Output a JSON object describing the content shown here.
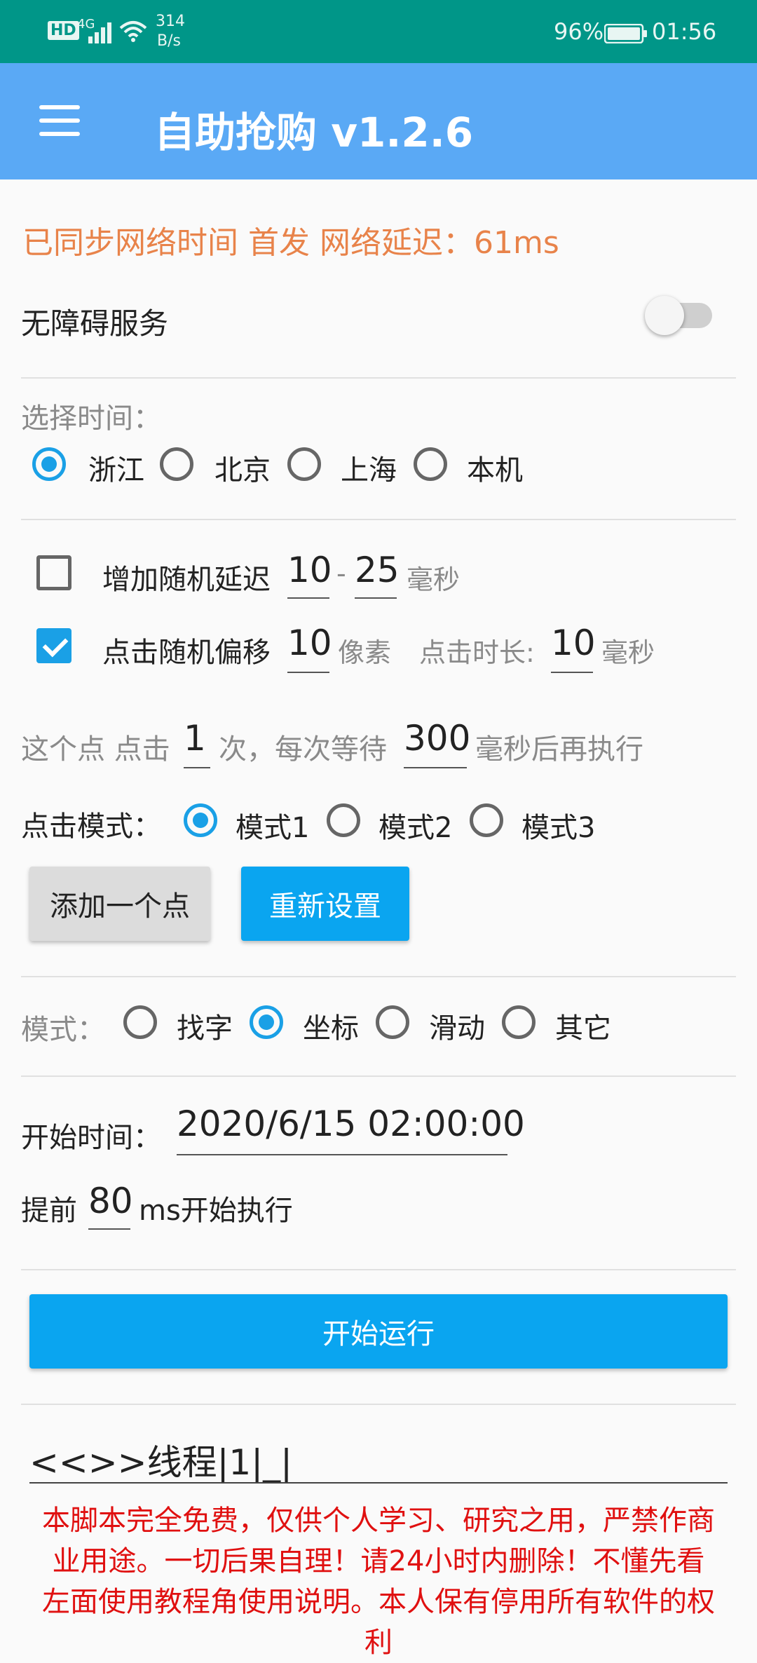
{
  "status_bar": {
    "hd": "HD",
    "network": "4G",
    "speed": "314",
    "speed_unit": "B/s",
    "battery": "96%",
    "time": "01:56"
  },
  "app_bar": {
    "title": "自助抢购 v1.2.6",
    "menu_icon": "hamburger-menu-icon"
  },
  "sync_status": "已同步网络时间 首发 网络延迟：61ms",
  "accessibility": {
    "label": "无障碍服务",
    "enabled": false
  },
  "time_select": {
    "label": "选择时间：",
    "options": [
      "浙江",
      "北京",
      "上海",
      "本机"
    ],
    "selected": "浙江"
  },
  "random_delay": {
    "checked": false,
    "label": "增加随机延迟",
    "min": "10",
    "dash": "-",
    "max": "25",
    "unit": "毫秒"
  },
  "random_offset": {
    "checked": true,
    "label": "点击随机偏移",
    "value": "10",
    "unit": "像素",
    "duration_label": "点击时长:",
    "duration_value": "10",
    "duration_unit": "毫秒"
  },
  "click_repeat": {
    "prefix": "这个点 点击",
    "count": "1",
    "middle": "次，每次等待",
    "wait": "300",
    "suffix": "毫秒后再执行"
  },
  "click_mode": {
    "label": "点击模式：",
    "options": [
      "模式1",
      "模式2",
      "模式3"
    ],
    "selected": "模式1"
  },
  "buttons": {
    "add_point": "添加一个点",
    "reset": "重新设置",
    "start": "开始运行"
  },
  "mode": {
    "label": "模式：",
    "options": [
      "找字",
      "坐标",
      "滑动",
      "其它"
    ],
    "selected": "坐标"
  },
  "start_time": {
    "label": "开始时间：",
    "value": "2020/6/15 02:00:00"
  },
  "advance": {
    "prefix": "提前",
    "value": "80",
    "suffix": "ms开始执行"
  },
  "thread_field": {
    "value": "<<>>线程|1|_|"
  },
  "disclaimer": {
    "lines": [
      "本脚本完全免费，仅供个人学习、研究之用，严禁作商",
      "业用途。一切后果自理！请24小时内删除！不懂先看",
      "左面使用教程角使用说明。本人保有停用所有软件的权",
      "利"
    ]
  },
  "colors": {
    "status_bar": "#009688",
    "app_bar": "#5aa9f5",
    "accent": "#1aa0e6",
    "sync_text": "#e8834a",
    "disclaimer": "#e01010"
  }
}
